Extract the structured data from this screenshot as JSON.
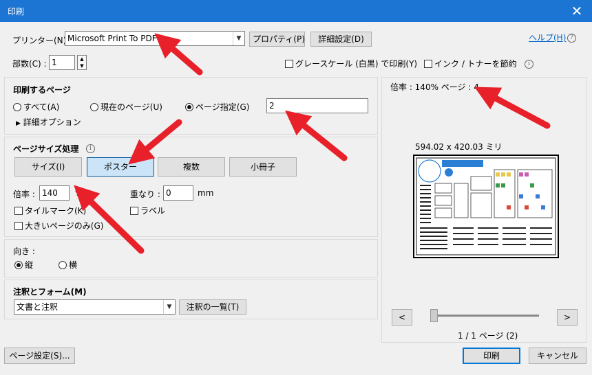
{
  "window": {
    "title": "印刷",
    "close_glyph": "✕"
  },
  "printer": {
    "label": "プリンター(N) :",
    "selected": "Microsoft Print To PDF",
    "properties_button": "プロパティ(P)",
    "advanced_button": "詳細設定(D)",
    "help_link": "ヘルプ(H)",
    "copies_label": "部数(C) :",
    "copies_value": "1",
    "grayscale_label": "グレースケール (白黒) で印刷(Y)",
    "grayscale_checked": false,
    "save_ink_label": "インク / トナーを節約",
    "save_ink_checked": false
  },
  "pages_to_print": {
    "heading": "印刷するページ",
    "options": [
      {
        "label": "すべて(A)",
        "selected": false
      },
      {
        "label": "現在のページ(U)",
        "selected": false
      },
      {
        "label": "ページ指定(G)",
        "selected": true
      }
    ],
    "range_value": "2",
    "more_options": "詳細オプション"
  },
  "page_sizing": {
    "heading": "ページサイズ処理",
    "buttons": [
      {
        "label": "サイズ(I)",
        "active": false
      },
      {
        "label": "ポスター",
        "active": true
      },
      {
        "label": "複数",
        "active": false
      },
      {
        "label": "小冊子",
        "active": false
      }
    ],
    "scale_label": "倍率 :",
    "scale_value": "140",
    "scale_unit": "%",
    "overlap_label": "重なり :",
    "overlap_value": "0",
    "overlap_unit": "mm",
    "tile_marks_label": "タイルマーク(K)",
    "labels_label": "ラベル",
    "large_pages_label": "大きいページのみ(G)"
  },
  "orientation": {
    "heading": "向き :",
    "options": [
      {
        "label": "縦",
        "selected": true
      },
      {
        "label": "横",
        "selected": false
      }
    ]
  },
  "comments": {
    "heading": "注釈とフォーム(M)",
    "selected": "文書と注釈",
    "summary_button": "注釈の一覧(T)"
  },
  "preview": {
    "scale_info": "倍率 : 140% ページ : 4",
    "dimensions": "594.02 x 420.03 ミリ",
    "prev_button": "<",
    "next_button": ">",
    "slider_position": 0,
    "page_indicator": "1 / 1 ページ (2)"
  },
  "footer": {
    "page_setup_button": "ページ設定(S)...",
    "print_button": "印刷",
    "cancel_button": "キャンセル"
  },
  "colors": {
    "titlebar": "#1c75d2",
    "link": "#0066cc",
    "annotation_arrow": "#e8202a"
  }
}
